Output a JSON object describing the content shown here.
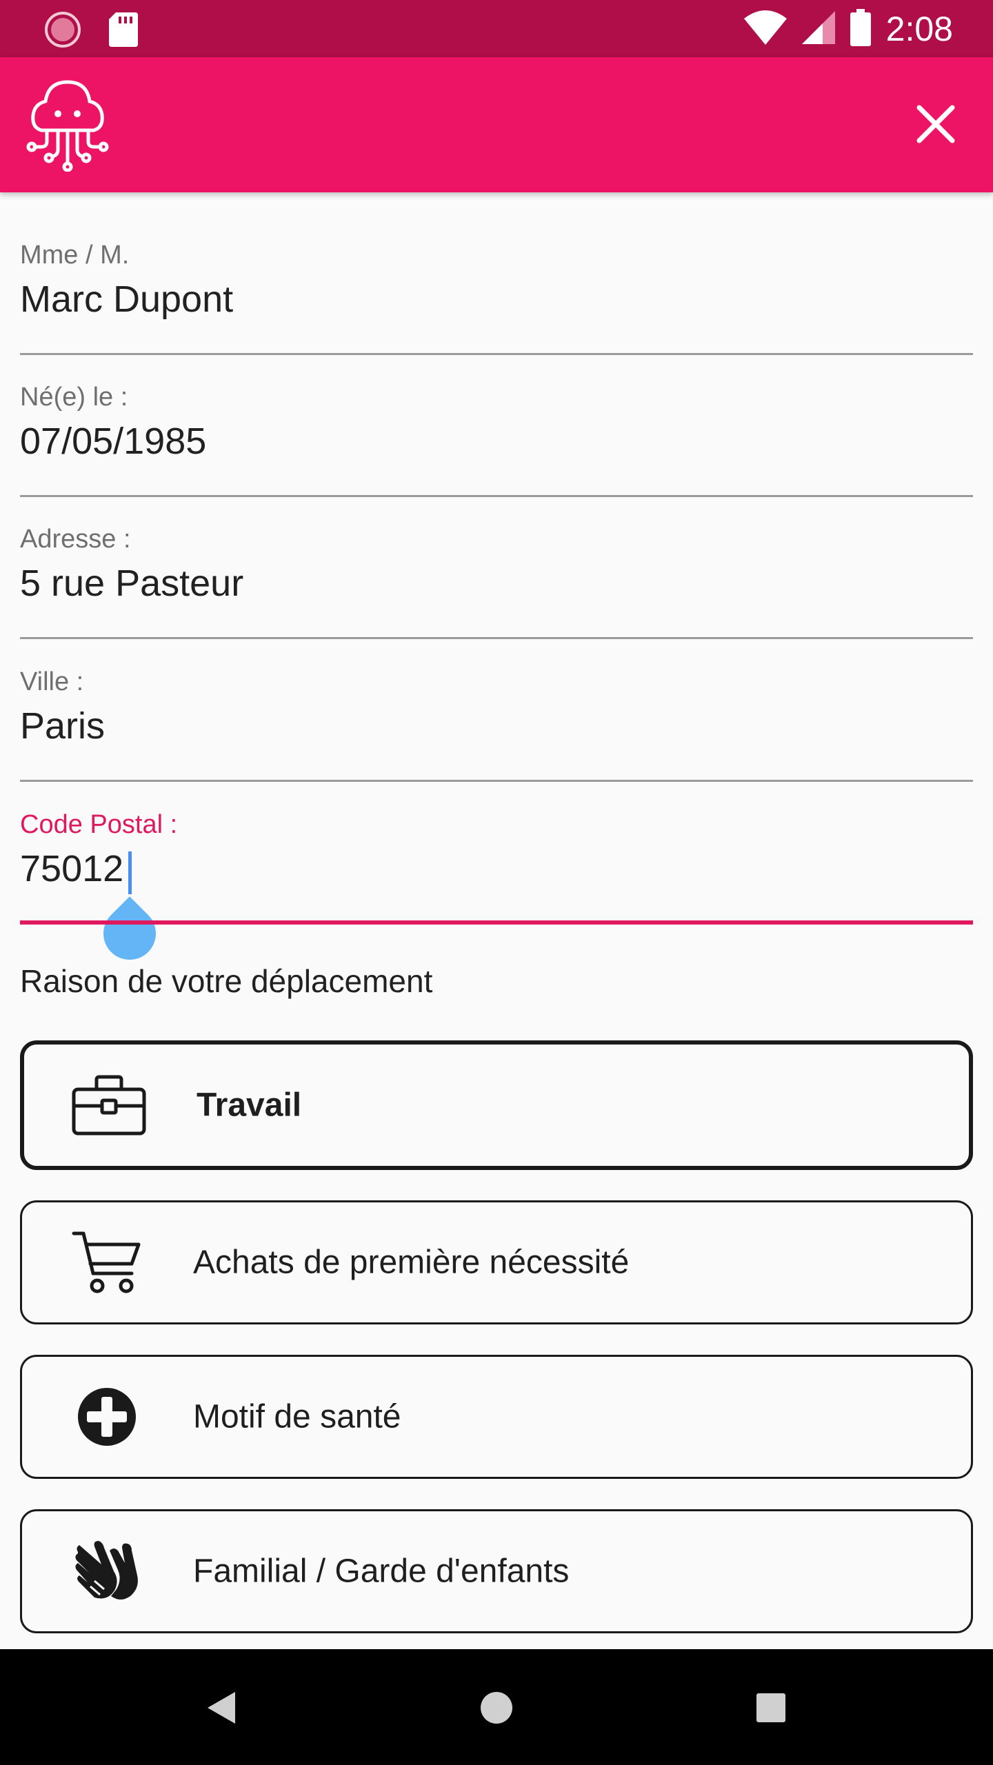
{
  "status_bar": {
    "time": "2:08",
    "icons": [
      "notification-circle-icon",
      "sd-card-icon",
      "wifi-icon",
      "signal-icon",
      "battery-icon"
    ]
  },
  "app_bar": {
    "logo_icon": "jellyfish-logo-icon",
    "close_icon": "close-icon"
  },
  "form": {
    "fields": [
      {
        "label": "Mme / M.",
        "value": "Marc Dupont"
      },
      {
        "label": "Né(e) le :",
        "value": "07/05/1985"
      },
      {
        "label": "Adresse :",
        "value": "5 rue Pasteur"
      },
      {
        "label": "Ville :",
        "value": "Paris"
      },
      {
        "label": "Code Postal :",
        "value": "75012"
      }
    ],
    "active_field": "Code Postal :"
  },
  "reasons": {
    "title": "Raison de votre déplacement",
    "items": [
      {
        "label": "Travail",
        "icon": "briefcase-icon",
        "selected": true
      },
      {
        "label": "Achats de première nécessité",
        "icon": "shopping-cart-icon",
        "selected": false
      },
      {
        "label": "Motif de santé",
        "icon": "health-cross-icon",
        "selected": false
      },
      {
        "label": "Familial / Garde d'enfants",
        "icon": "holding-hands-icon",
        "selected": false
      }
    ]
  },
  "nav_bar": {
    "buttons": [
      "back-icon",
      "home-icon",
      "recents-icon"
    ]
  },
  "colors": {
    "status_bar": "#b00e48",
    "app_bar": "#ed1465",
    "accent": "#e0195f",
    "cursor": "#64b5f6"
  }
}
